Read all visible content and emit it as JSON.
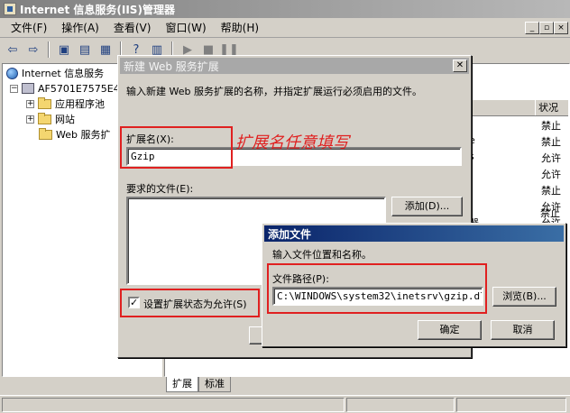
{
  "window": {
    "title": "Internet 信息服务(IIS)管理器"
  },
  "menu": [
    "文件(F)",
    "操作(A)",
    "查看(V)",
    "窗口(W)",
    "帮助(H)"
  ],
  "toolbar_icons": [
    "back-arrow-icon",
    "forward-arrow-icon",
    "up-folder-icon",
    "show-tree-icon",
    "export-icon",
    "help-icon",
    "properties-icon",
    "play-icon",
    "stop-icon",
    "pause-icon"
  ],
  "tree": {
    "root": "Internet 信息服务",
    "server": "AF5701E7575E47",
    "app_pools": "应用程序池",
    "sites": "网站",
    "web_ext": "Web 服务扩"
  },
  "list": {
    "status_header": "状况",
    "statuses": [
      "禁止",
      "禁止",
      "允许",
      "允许",
      "禁止",
      "允许",
      "允许",
      "禁止"
    ],
    "partial_names": [
      "e",
      "s",
      "器"
    ]
  },
  "tabs": [
    "扩展",
    "标准"
  ],
  "dialog1": {
    "title": "新建 Web 服务扩展",
    "instruction": "输入新建 Web 服务扩展的名称，并指定扩展运行必须启用的文件。",
    "ext_name_label": "扩展名(X):",
    "ext_name_value": "Gzip",
    "annotation": "扩展名任意填写",
    "required_files_label": "要求的文件(E):",
    "add_button": "添加(D)...",
    "checkbox_label": "设置扩展状态为允许(S)",
    "checkbox_checked": true
  },
  "dialog2": {
    "title": "添加文件",
    "instruction": "输入文件位置和名称。",
    "path_label": "文件路径(P):",
    "path_value": "C:\\WINDOWS\\system32\\inetsrv\\gzip.dll",
    "browse_button": "浏览(B)...",
    "ok_button": "确定",
    "cancel_button": "取消"
  },
  "colors": {
    "highlight_red": "#e02020",
    "active_title": "#0a246a",
    "inactive_title": "#a8a8a8"
  }
}
